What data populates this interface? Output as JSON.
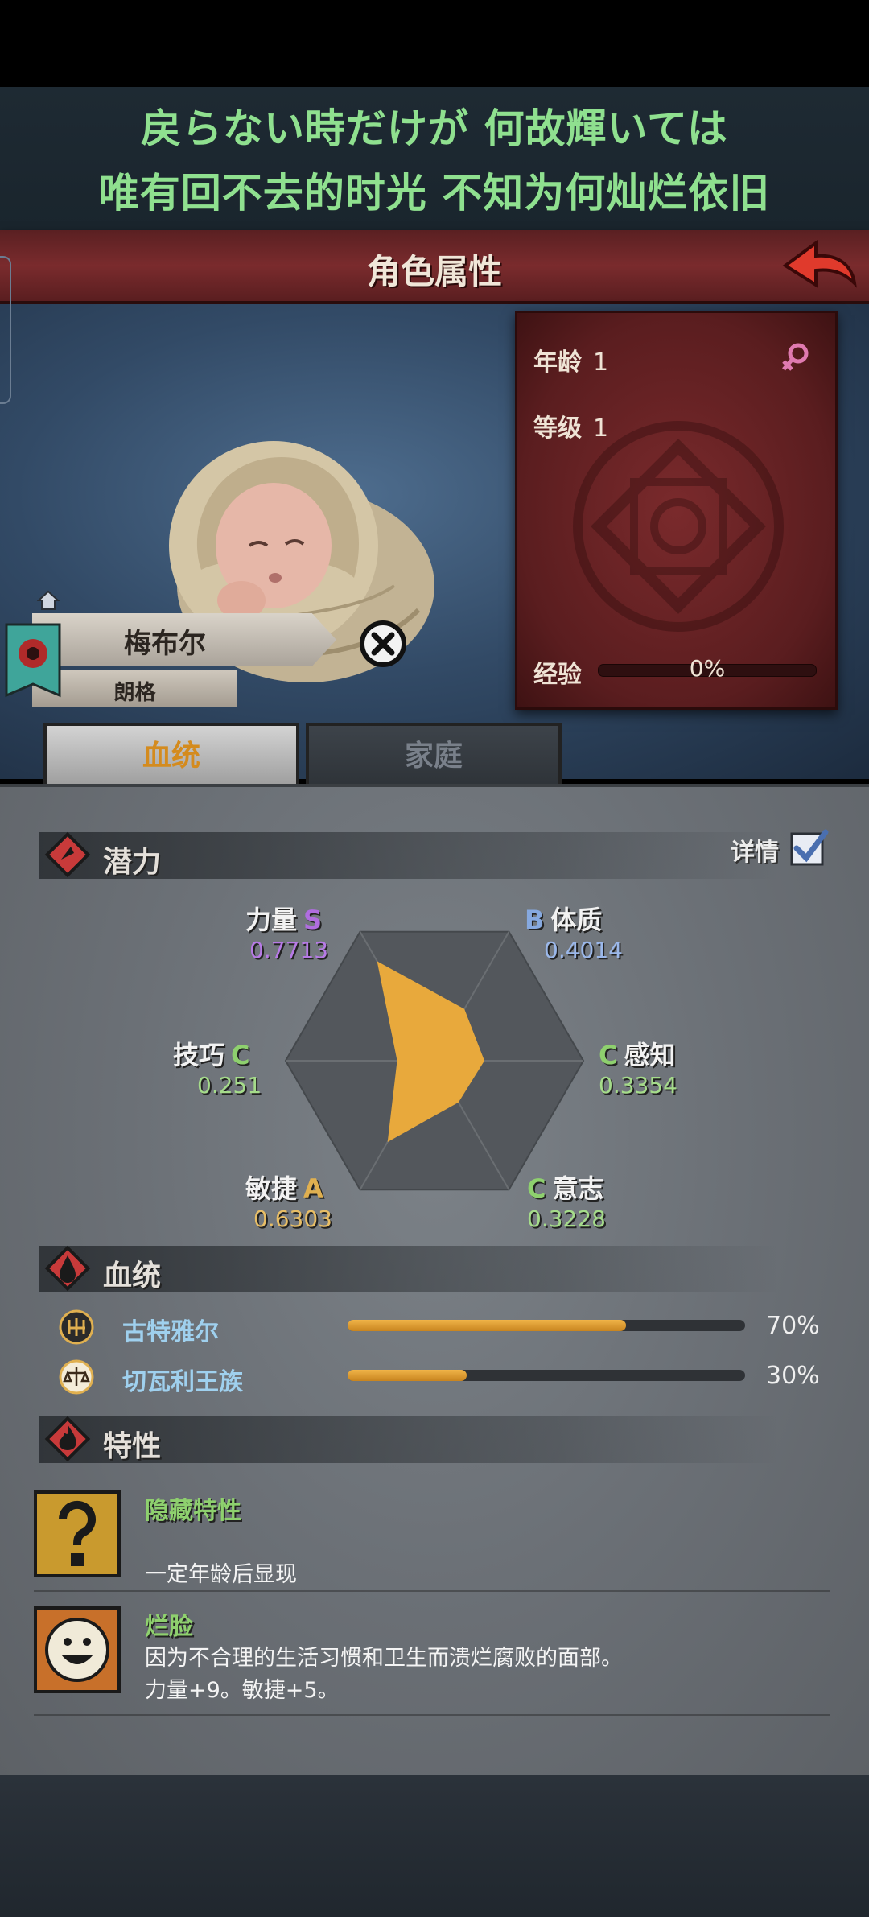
{
  "lyrics": {
    "line1": "戻らない時だけが 何故輝いては",
    "line2": "唯有回不去的时光 不知为何灿烂依旧"
  },
  "header": {
    "title": "角色属性"
  },
  "character": {
    "age_label": "年龄",
    "age": "1",
    "level_label": "等级",
    "level": "1",
    "exp_label": "经验",
    "exp": "0%",
    "name": "梅布尔",
    "sub": "朗格"
  },
  "tabs": [
    {
      "label": "血统",
      "active": true
    },
    {
      "label": "家庭",
      "active": false
    }
  ],
  "potential": {
    "title": "潜力",
    "detail_label": "详情",
    "stats": [
      {
        "name": "力量",
        "grade": "S",
        "value": 0.7713
      },
      {
        "name": "体质",
        "grade": "B",
        "value": 0.4014
      },
      {
        "name": "感知",
        "grade": "C",
        "value": 0.3354
      },
      {
        "name": "意志",
        "grade": "C",
        "value": 0.3228
      },
      {
        "name": "敏捷",
        "grade": "A",
        "value": 0.6303
      },
      {
        "name": "技巧",
        "grade": "C",
        "value": 0.251
      }
    ],
    "stat_text": {
      "str": "0.7713",
      "con": "0.4014",
      "per": "0.3354",
      "wil": "0.3228",
      "agi": "0.6303",
      "ski": "0.251"
    }
  },
  "lineage": {
    "title": "血统",
    "items": [
      {
        "name": "古特雅尔",
        "percent": "70%",
        "fraction": 0.7
      },
      {
        "name": "切瓦利王族",
        "percent": "30%",
        "fraction": 0.3
      }
    ]
  },
  "traits": {
    "title": "特性",
    "items": [
      {
        "name": "隐藏特性",
        "desc": "一定年龄后显现",
        "desc2": "",
        "icon": "question-mark-icon"
      },
      {
        "name": "烂脸",
        "desc": "因为不合理的生活习惯和卫生而溃烂腐败的面部。",
        "desc2": "力量+9。敏捷+5。",
        "icon": "grinning-face-icon"
      }
    ]
  },
  "colors": {
    "accent_orange": "#e8a93c",
    "trait_green": "#8ed06e",
    "panel_red": "#6b2426"
  }
}
